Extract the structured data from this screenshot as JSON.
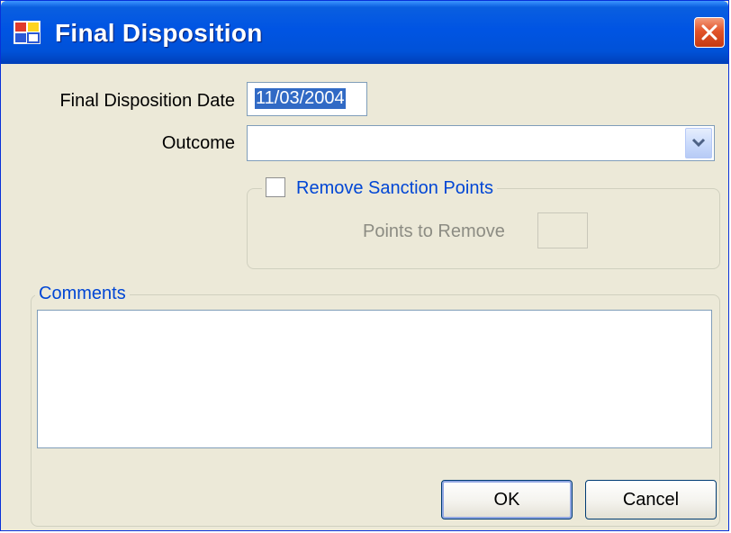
{
  "window": {
    "title": "Final Disposition",
    "icon": "app-window-icon",
    "close_icon": "close-x-icon"
  },
  "form": {
    "date_label": "Final Disposition Date",
    "date_value": "11/03/2004",
    "outcome_label": "Outcome",
    "outcome_value": "",
    "sanction_group": {
      "checkbox_label": "Remove Sanction Points",
      "checked": false,
      "points_label": "Points to Remove",
      "points_value": ""
    },
    "comments_label": "Comments",
    "comments_value": ""
  },
  "buttons": {
    "ok": "OK",
    "cancel": "Cancel"
  },
  "colors": {
    "titlebar": "#0054e3",
    "dialog_bg": "#ece9d8",
    "group_label": "#0046d5",
    "selection": "#316ac5"
  }
}
